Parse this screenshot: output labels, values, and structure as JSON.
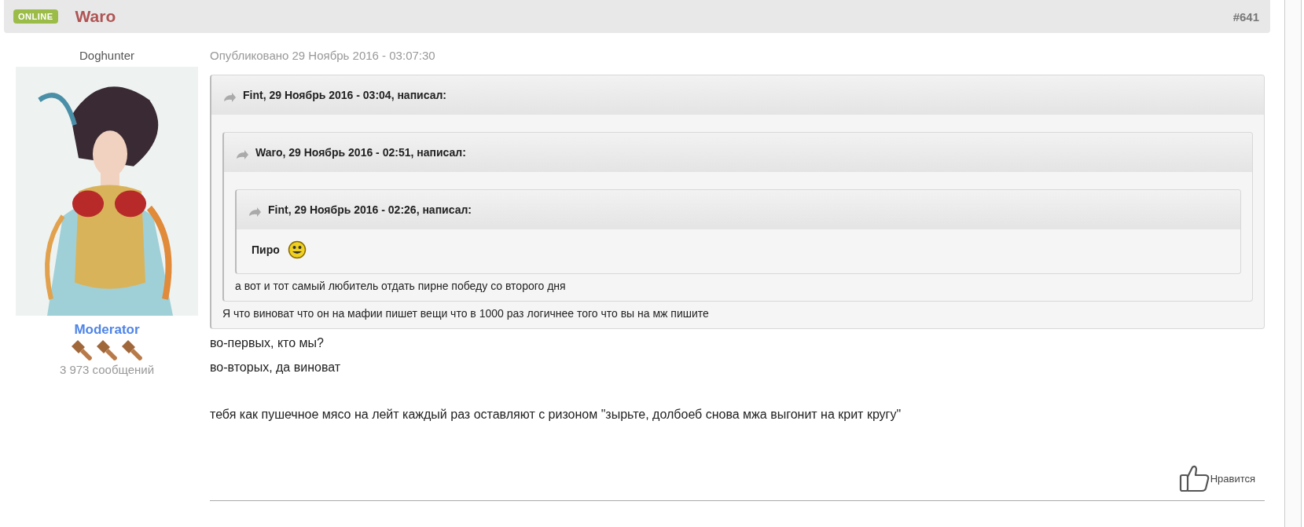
{
  "post": {
    "status": "ONLINE",
    "author": "Waro",
    "number": "#641"
  },
  "profile": {
    "username": "Doghunter",
    "group": "Moderator",
    "stars": 3,
    "post_count": "3 973 сообщений"
  },
  "published": "Опубликовано 29 Ноябрь 2016 - 03:07:30",
  "quote": {
    "citation": "Fint, 29 Ноябрь 2016 - 03:04, написал:",
    "text": "Я что виноват что он на мафии пишет вещи что в 1000 раз логичнее того что вы на мж пишите",
    "bold": false,
    "smiley": false,
    "quote": {
      "citation": "Waro, 29 Ноябрь 2016 - 02:51, написал:",
      "text": "а вот и тот самый любитель отдать пирне победу со второго дня",
      "bold": false,
      "smiley": false,
      "quote": {
        "citation": "Fint, 29 Ноябрь 2016 - 02:26, написал:",
        "text": "Пиро",
        "bold": true,
        "smiley": true
      }
    }
  },
  "body": [
    [
      "во-первых, кто мы?",
      "во-вторых, да виноват"
    ],
    [
      "тебя как пушечное мясо на лейт каждый раз оставляют с ризоном \"зырьте, долбоеб снова мжа выгонит на крит кругу\""
    ]
  ],
  "like": {
    "label": "Нравится"
  }
}
